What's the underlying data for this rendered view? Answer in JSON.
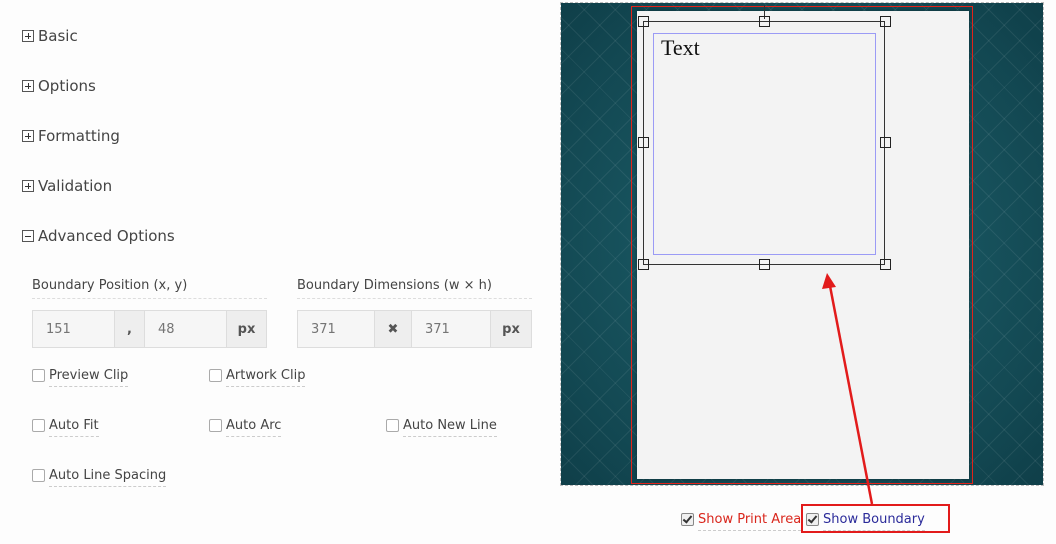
{
  "sections": [
    {
      "label": "Basic",
      "expanded": false
    },
    {
      "label": "Options",
      "expanded": false
    },
    {
      "label": "Formatting",
      "expanded": false
    },
    {
      "label": "Validation",
      "expanded": false
    },
    {
      "label": "Advanced Options",
      "expanded": true
    }
  ],
  "advanced": {
    "boundary_position": {
      "label": "Boundary Position (x, y)",
      "x_placeholder": "151",
      "separator": ",",
      "y_placeholder": "48",
      "unit": "px"
    },
    "boundary_dimensions": {
      "label": "Boundary Dimensions (w × h)",
      "w_placeholder": "371",
      "separator": "✖",
      "h_placeholder": "371",
      "unit": "px"
    },
    "checkboxes": {
      "preview_clip": {
        "label": "Preview Clip",
        "checked": false
      },
      "artwork_clip": {
        "label": "Artwork Clip",
        "checked": false
      },
      "auto_fit": {
        "label": "Auto Fit",
        "checked": false
      },
      "auto_arc": {
        "label": "Auto Arc",
        "checked": false
      },
      "auto_new_line": {
        "label": "Auto New Line",
        "checked": false
      },
      "auto_line_spacing": {
        "label": "Auto Line Spacing",
        "checked": false
      }
    }
  },
  "preview": {
    "canvas_text": "Text",
    "show_print_area": {
      "label": "Show Print Area",
      "checked": true,
      "color": "#d9261c"
    },
    "show_boundary": {
      "label": "Show Boundary",
      "checked": true,
      "color": "#2b2b9a"
    }
  },
  "colors": {
    "print_area": "#e2231a",
    "boundary": "#9b9bf5",
    "annotation": "#e21b1b",
    "pattern_bg": "#1a5560"
  }
}
